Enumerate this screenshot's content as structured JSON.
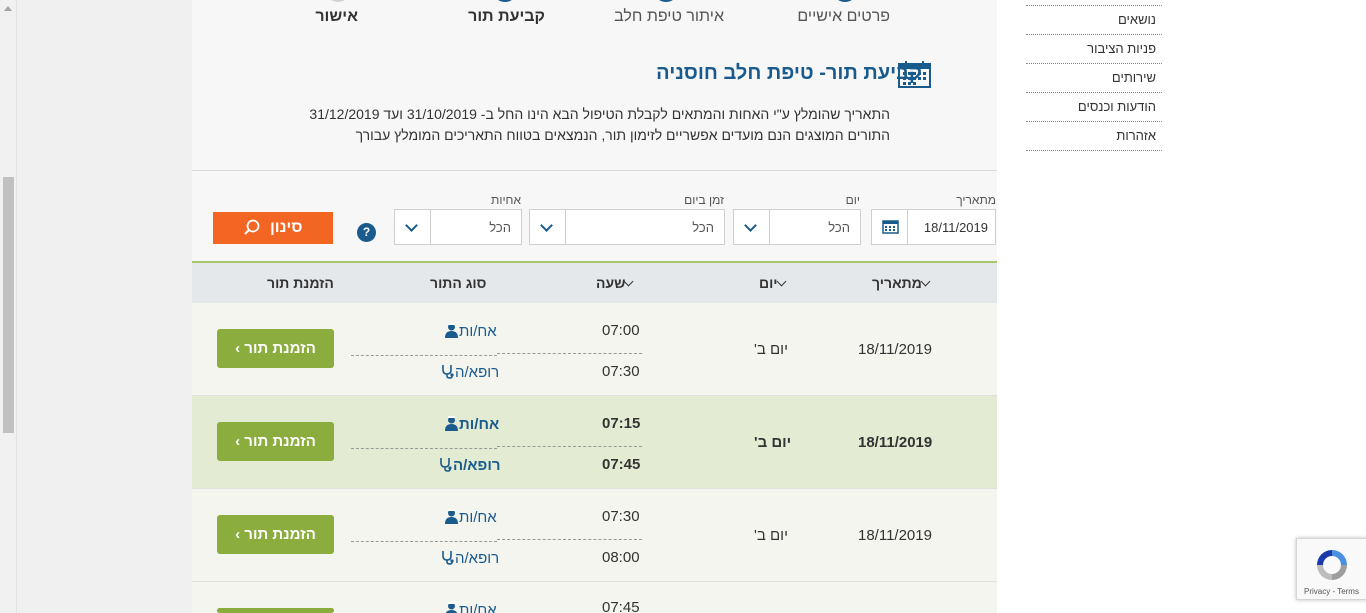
{
  "steps": [
    {
      "label": "פרטים אישיים"
    },
    {
      "label": "איתור טיפת חלב"
    },
    {
      "label": "קביעת תור"
    },
    {
      "label": "אישור"
    }
  ],
  "title": "קביעת תור- טיפת חלב חוסניה",
  "notice": {
    "line1": "התאריך שהומלץ ע\"י האחות והמתאים לקבלת הטיפול הבא הינו החל ב- 31/10/2019 ועד 31/12/2019",
    "line2": "התורים המוצגים הנם מועדים אפשריים לזימון תור, הנמצאים בטווח התאריכים המומלץ עבורך"
  },
  "filters": {
    "date_label": "מתאריך",
    "date_value": "18/11/2019",
    "day_label": "יום",
    "day_value": "הכל",
    "time_label": "זמן ביום",
    "time_value": "הכל",
    "nurse_label": "אחיות",
    "nurse_value": "הכל",
    "help": "?",
    "filter_button": "סינון"
  },
  "table": {
    "headers": {
      "date": "מתאריך",
      "day": "יום",
      "time": "שעה",
      "type": "סוג התור",
      "book": "הזמנת תור"
    },
    "rows": [
      {
        "date": "18/11/2019",
        "day": "יום ב'",
        "time1": "07:00",
        "time2": "07:30",
        "type1": "אח/ות",
        "type2": "רופא/ה",
        "book": "הזמנת תור ›"
      },
      {
        "date": "18/11/2019",
        "day": "יום ב'",
        "time1": "07:15",
        "time2": "07:45",
        "type1": "אח/ות",
        "type2": "רופא/ה",
        "book": "הזמנת תור ›"
      },
      {
        "date": "18/11/2019",
        "day": "יום ב'",
        "time1": "07:30",
        "time2": "08:00",
        "type1": "אח/ות",
        "type2": "רופא/ה",
        "book": "הזמנת תור ›"
      },
      {
        "time1": "07:45",
        "type1": "אח/ות"
      }
    ]
  },
  "sidebar": {
    "items": [
      {
        "label": "נושאים"
      },
      {
        "label": "פניות הציבור"
      },
      {
        "label": "שירותים"
      },
      {
        "label": "הודעות וכנסים"
      },
      {
        "label": "אזהרות"
      }
    ]
  },
  "recaptcha": {
    "terms": "Privacy - Terms"
  },
  "colors": {
    "primary": "#1a5b8e",
    "accent": "#8aad3e",
    "filter": "#f26522"
  }
}
